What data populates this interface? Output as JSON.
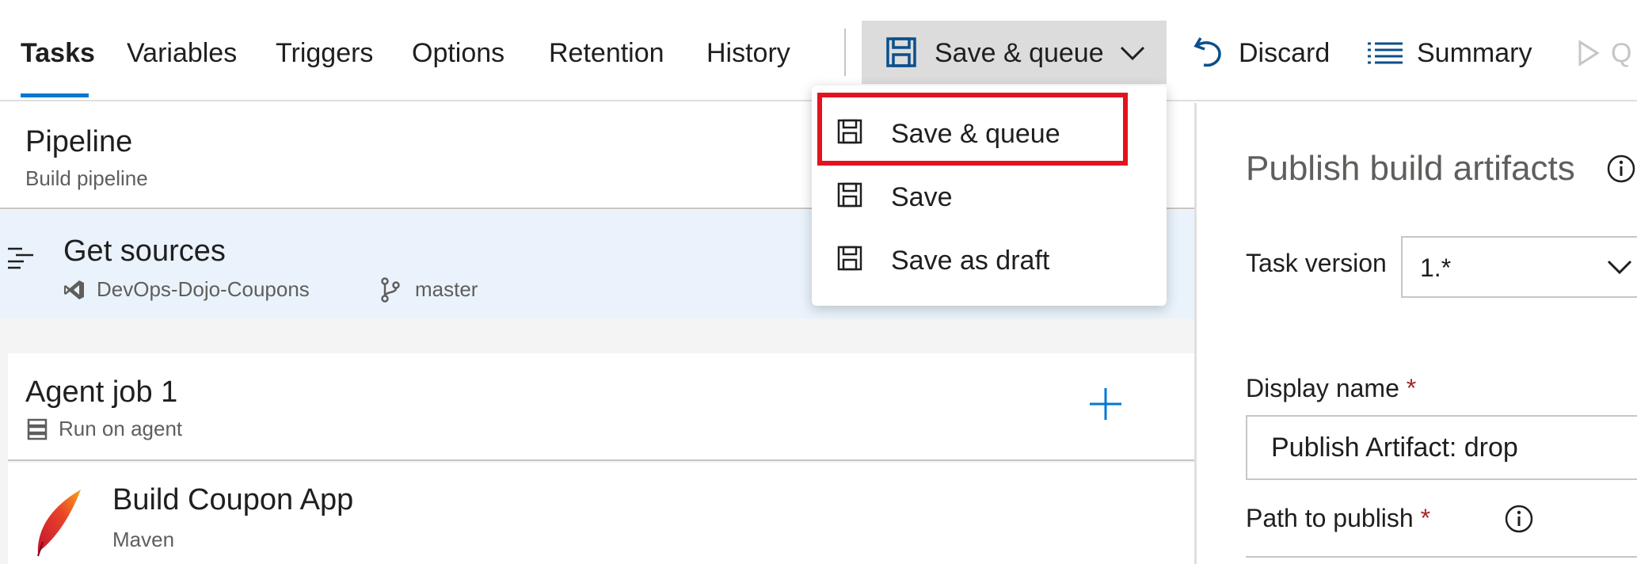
{
  "tabs": [
    {
      "label": "Tasks",
      "active": true
    },
    {
      "label": "Variables"
    },
    {
      "label": "Triggers"
    },
    {
      "label": "Options"
    },
    {
      "label": "Retention"
    },
    {
      "label": "History"
    }
  ],
  "toolbar": {
    "save_queue_label": "Save & queue",
    "discard_label": "Discard",
    "summary_label": "Summary",
    "queue_partial_label": "Q"
  },
  "menu": {
    "items": [
      {
        "label": "Save & queue",
        "highlighted": true
      },
      {
        "label": "Save"
      },
      {
        "label": "Save as draft"
      }
    ]
  },
  "pipeline": {
    "title": "Pipeline",
    "subtitle": "Build pipeline"
  },
  "get_sources": {
    "title": "Get sources",
    "repo": "DevOps-Dojo-Coupons",
    "branch": "master"
  },
  "agent_job": {
    "title": "Agent job 1",
    "subtitle": "Run on agent"
  },
  "build_task": {
    "title": "Build Coupon App",
    "subtitle": "Maven"
  },
  "task_panel": {
    "title": "Publish build artifacts",
    "task_version_label": "Task version",
    "task_version_value": "1.*",
    "display_name_label": "Display name",
    "display_name_value": "Publish Artifact: drop",
    "path_label": "Path to publish",
    "required_marker": "*"
  },
  "colors": {
    "accent": "#0078d4",
    "highlight": "#e3121f",
    "selected_row": "#eaf3fc"
  }
}
